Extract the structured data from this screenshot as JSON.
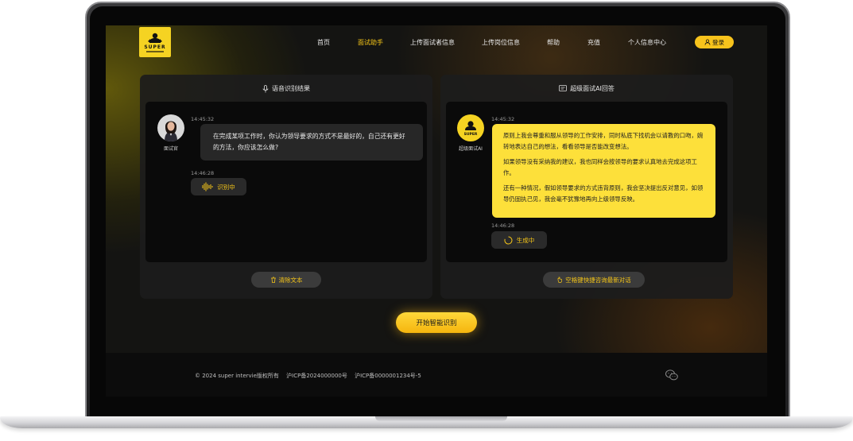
{
  "brand": {
    "logo_text": "SUPER"
  },
  "nav": {
    "items": [
      "首页",
      "面试助手",
      "上传面试者信息",
      "上传岗位信息",
      "帮助",
      "充值",
      "个人信息中心"
    ],
    "active_index": 1,
    "login_label": "登录"
  },
  "left_panel": {
    "title": "语音识别结果",
    "avatar_label": "面试官",
    "messages": [
      {
        "time": "14:45:32",
        "text": "在完成某项工作时，你认为领导要求的方式不是最好的，自己还有更好的方法，你应该怎么做?"
      },
      {
        "time": "14:46:28",
        "status": "识别中"
      }
    ],
    "clear_button": "清除文本"
  },
  "right_panel": {
    "title": "超级面试AI回答",
    "avatar_label": "超级面试AI",
    "answer_time": "14:45:32",
    "answer_paragraphs": [
      "原则上我会尊重和服从领导的工作安排，同时私底下找机会以请教的口吻，婉转地表达自己的想法，看看领导是否能改变想法。",
      "如果领导没有采纳我的建议，我也同样会按领导的要求认真地去完成这项工作。",
      "还有一种情况，假如领导要求的方式违背原则，我会坚决提出反对意见，如领导仍固执己见，我会毫不犹豫地再向上级领导反映。"
    ],
    "generating_time": "14:46:28",
    "generating_status": "生成中",
    "shortcut_button": "空格键快捷咨询最新对话"
  },
  "start_button": "开始智能识别",
  "footer": {
    "copyright": "© 2024 super intervie版权所有",
    "icp1": "沪ICP备2024000000号",
    "icp2": "沪ICP备0000001234号-5"
  },
  "colors": {
    "accent": "#f5c518",
    "bubble_yellow": "#fde03a",
    "panel_bg": "#1c1c1c"
  }
}
